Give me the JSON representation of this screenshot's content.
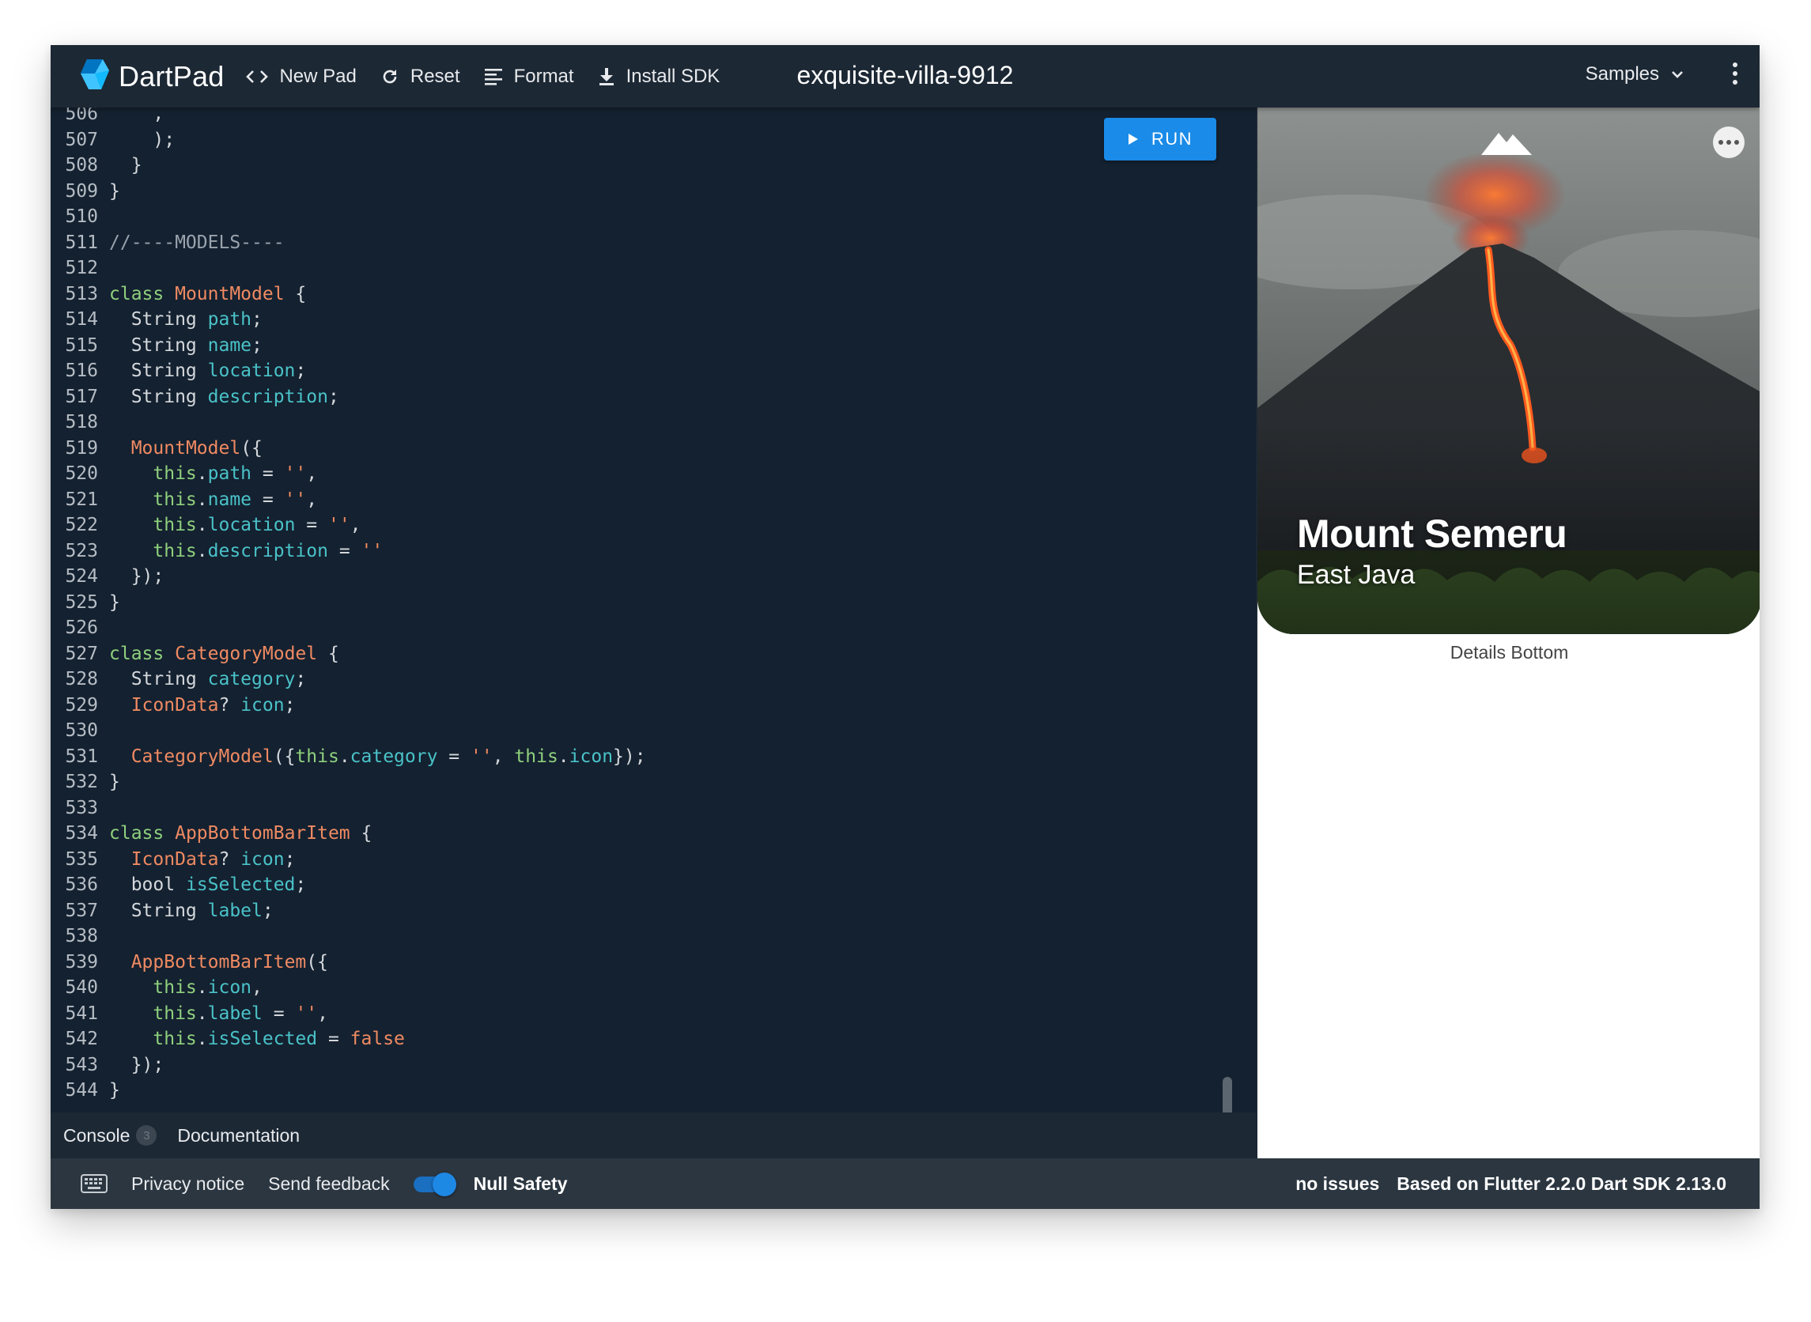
{
  "app": {
    "name": "DartPad",
    "pad_title": "exquisite-villa-9912"
  },
  "toolbar": {
    "new_pad": "New Pad",
    "reset": "Reset",
    "format": "Format",
    "install_sdk": "Install SDK",
    "samples": "Samples"
  },
  "editor": {
    "run_label": "RUN",
    "lines": [
      {
        "n": "506",
        "t": [
          [
            "    ",
            ""
          ],
          [
            ",",
            ""
          ]
        ]
      },
      {
        "n": "507",
        "t": [
          [
            "    );",
            ""
          ]
        ]
      },
      {
        "n": "508",
        "t": [
          [
            "  }",
            ""
          ]
        ]
      },
      {
        "n": "509",
        "t": [
          [
            "}",
            ""
          ]
        ]
      },
      {
        "n": "510",
        "t": []
      },
      {
        "n": "511",
        "t": [
          [
            "//----MODELS----",
            "cm"
          ]
        ]
      },
      {
        "n": "512",
        "t": []
      },
      {
        "n": "513",
        "t": [
          [
            "class ",
            "k"
          ],
          [
            "MountModel",
            "c"
          ],
          [
            " {",
            ""
          ]
        ]
      },
      {
        "n": "514",
        "t": [
          [
            "  String ",
            ""
          ],
          [
            "path",
            "p"
          ],
          [
            ";",
            ""
          ]
        ]
      },
      {
        "n": "515",
        "t": [
          [
            "  String ",
            ""
          ],
          [
            "name",
            "p"
          ],
          [
            ";",
            ""
          ]
        ]
      },
      {
        "n": "516",
        "t": [
          [
            "  String ",
            ""
          ],
          [
            "location",
            "p"
          ],
          [
            ";",
            ""
          ]
        ]
      },
      {
        "n": "517",
        "t": [
          [
            "  String ",
            ""
          ],
          [
            "description",
            "p"
          ],
          [
            ";",
            ""
          ]
        ]
      },
      {
        "n": "518",
        "t": []
      },
      {
        "n": "519",
        "t": [
          [
            "  ",
            ""
          ],
          [
            "MountModel",
            "c"
          ],
          [
            "({",
            ""
          ]
        ]
      },
      {
        "n": "520",
        "t": [
          [
            "    ",
            ""
          ],
          [
            "this",
            "k"
          ],
          [
            ".",
            ""
          ],
          [
            "path",
            "p"
          ],
          [
            " = ",
            ""
          ],
          [
            "''",
            "s"
          ],
          [
            ",",
            ""
          ]
        ]
      },
      {
        "n": "521",
        "t": [
          [
            "    ",
            ""
          ],
          [
            "this",
            "k"
          ],
          [
            ".",
            ""
          ],
          [
            "name",
            "p"
          ],
          [
            " = ",
            ""
          ],
          [
            "''",
            "s"
          ],
          [
            ",",
            ""
          ]
        ]
      },
      {
        "n": "522",
        "t": [
          [
            "    ",
            ""
          ],
          [
            "this",
            "k"
          ],
          [
            ".",
            ""
          ],
          [
            "location",
            "p"
          ],
          [
            " = ",
            ""
          ],
          [
            "''",
            "s"
          ],
          [
            ",",
            ""
          ]
        ]
      },
      {
        "n": "523",
        "t": [
          [
            "    ",
            ""
          ],
          [
            "this",
            "k"
          ],
          [
            ".",
            ""
          ],
          [
            "description",
            "p"
          ],
          [
            " = ",
            ""
          ],
          [
            "''",
            "s"
          ]
        ]
      },
      {
        "n": "524",
        "t": [
          [
            "  });",
            ""
          ]
        ]
      },
      {
        "n": "525",
        "t": [
          [
            "}",
            ""
          ]
        ]
      },
      {
        "n": "526",
        "t": []
      },
      {
        "n": "527",
        "t": [
          [
            "class ",
            "k"
          ],
          [
            "CategoryModel",
            "c"
          ],
          [
            " {",
            ""
          ]
        ]
      },
      {
        "n": "528",
        "t": [
          [
            "  String ",
            ""
          ],
          [
            "category",
            "p"
          ],
          [
            ";",
            ""
          ]
        ]
      },
      {
        "n": "529",
        "t": [
          [
            "  ",
            ""
          ],
          [
            "IconData",
            "c"
          ],
          [
            "? ",
            ""
          ],
          [
            "icon",
            "p"
          ],
          [
            ";",
            ""
          ]
        ]
      },
      {
        "n": "530",
        "t": []
      },
      {
        "n": "531",
        "t": [
          [
            "  ",
            ""
          ],
          [
            "CategoryModel",
            "c"
          ],
          [
            "({",
            ""
          ],
          [
            "this",
            "k"
          ],
          [
            ".",
            ""
          ],
          [
            "category",
            "p"
          ],
          [
            " = ",
            ""
          ],
          [
            "''",
            "s"
          ],
          [
            ", ",
            ""
          ],
          [
            "this",
            "k"
          ],
          [
            ".",
            ""
          ],
          [
            "icon",
            "p"
          ],
          [
            "});",
            ""
          ]
        ]
      },
      {
        "n": "532",
        "t": [
          [
            "}",
            ""
          ]
        ]
      },
      {
        "n": "533",
        "t": []
      },
      {
        "n": "534",
        "t": [
          [
            "class ",
            "k"
          ],
          [
            "AppBottomBarItem",
            "c"
          ],
          [
            " {",
            ""
          ]
        ]
      },
      {
        "n": "535",
        "t": [
          [
            "  ",
            ""
          ],
          [
            "IconData",
            "c"
          ],
          [
            "? ",
            ""
          ],
          [
            "icon",
            "p"
          ],
          [
            ";",
            ""
          ]
        ]
      },
      {
        "n": "536",
        "t": [
          [
            "  bool ",
            ""
          ],
          [
            "isSelected",
            "p"
          ],
          [
            ";",
            ""
          ]
        ]
      },
      {
        "n": "537",
        "t": [
          [
            "  String ",
            ""
          ],
          [
            "label",
            "p"
          ],
          [
            ";",
            ""
          ]
        ]
      },
      {
        "n": "538",
        "t": []
      },
      {
        "n": "539",
        "t": [
          [
            "  ",
            ""
          ],
          [
            "AppBottomBarItem",
            "c"
          ],
          [
            "({",
            ""
          ]
        ]
      },
      {
        "n": "540",
        "t": [
          [
            "    ",
            ""
          ],
          [
            "this",
            "k"
          ],
          [
            ".",
            ""
          ],
          [
            "icon",
            "p"
          ],
          [
            ",",
            ""
          ]
        ]
      },
      {
        "n": "541",
        "t": [
          [
            "    ",
            ""
          ],
          [
            "this",
            "k"
          ],
          [
            ".",
            ""
          ],
          [
            "label",
            "p"
          ],
          [
            " = ",
            ""
          ],
          [
            "''",
            "s"
          ],
          [
            ",",
            ""
          ]
        ]
      },
      {
        "n": "542",
        "t": [
          [
            "    ",
            ""
          ],
          [
            "this",
            "k"
          ],
          [
            ".",
            ""
          ],
          [
            "isSelected",
            "p"
          ],
          [
            " = ",
            ""
          ],
          [
            "false",
            "s"
          ]
        ]
      },
      {
        "n": "543",
        "t": [
          [
            "  });",
            ""
          ]
        ]
      },
      {
        "n": "544",
        "t": [
          [
            "}",
            ""
          ]
        ]
      }
    ]
  },
  "tabs": {
    "console": "Console",
    "console_count": "3",
    "documentation": "Documentation"
  },
  "footer": {
    "privacy": "Privacy notice",
    "feedback": "Send feedback",
    "null_safety": "Null Safety",
    "null_safety_enabled": true,
    "issues": "no issues",
    "version": "Based on Flutter 2.2.0 Dart SDK 2.13.0"
  },
  "preview": {
    "title": "Mount Semeru",
    "subtitle": "East Java",
    "details_label": "Details Bottom"
  },
  "icons": {
    "new_pad": "code-brackets-icon",
    "reset": "refresh-icon",
    "format": "format-lines-icon",
    "install_sdk": "download-icon",
    "samples": "chevron-down-icon",
    "menu": "kebab-menu-icon",
    "run": "play-icon",
    "keyboard": "keyboard-icon",
    "preview_top": "mountain-icon",
    "preview_more": "more-horizontal-icon"
  },
  "colors": {
    "run_button": "#1a8be8",
    "keyword": "#8fd07d",
    "class_name": "#ef8a62",
    "property": "#4ac2c8",
    "toggle": "#1e88e5"
  }
}
